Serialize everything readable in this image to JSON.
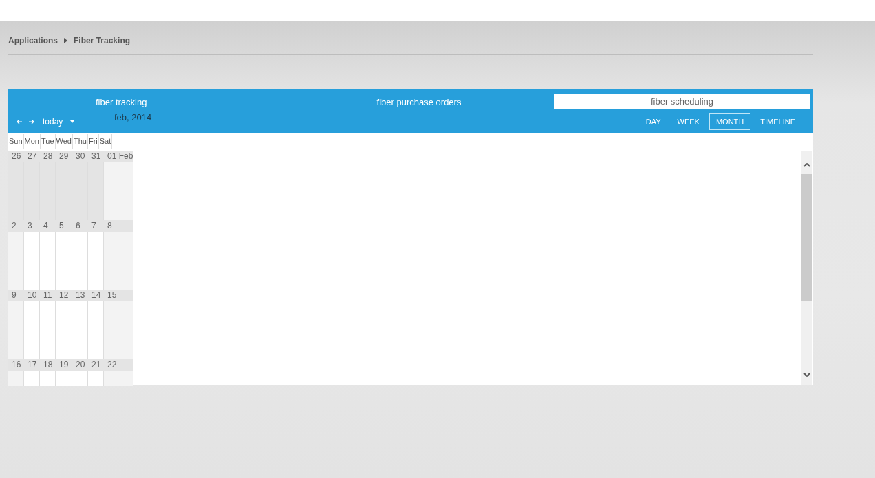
{
  "breadcrumb": [
    "Applications",
    "Fiber Tracking"
  ],
  "header": {
    "left_title": "fiber tracking",
    "center_title": "fiber purchase orders",
    "search": {
      "value": "fiber scheduling"
    },
    "today": "today",
    "month_label": "feb, 2014",
    "views": [
      {
        "label": "DAY",
        "selected": false
      },
      {
        "label": "WEEK",
        "selected": false
      },
      {
        "label": "MONTH",
        "selected": true
      },
      {
        "label": "TIMELINE",
        "selected": false
      }
    ]
  },
  "weekdays": [
    "Sun",
    "Mon",
    "Tue",
    "Wed",
    "Thu",
    "Fri",
    "Sat"
  ],
  "weeks": [
    [
      {
        "label": "26",
        "other_month": true
      },
      {
        "label": "27",
        "other_month": true
      },
      {
        "label": "28",
        "other_month": true
      },
      {
        "label": "29",
        "other_month": true
      },
      {
        "label": "30",
        "other_month": true
      },
      {
        "label": "31",
        "other_month": true
      },
      {
        "label": "01 Feb",
        "other_month": false
      }
    ],
    [
      {
        "label": "2",
        "other_month": false
      },
      {
        "label": "3",
        "other_month": false
      },
      {
        "label": "4",
        "other_month": false
      },
      {
        "label": "5",
        "other_month": false
      },
      {
        "label": "6",
        "other_month": false
      },
      {
        "label": "7",
        "other_month": false
      },
      {
        "label": "8",
        "other_month": false
      }
    ],
    [
      {
        "label": "9",
        "other_month": false
      },
      {
        "label": "10",
        "other_month": false
      },
      {
        "label": "11",
        "other_month": false
      },
      {
        "label": "12",
        "other_month": false
      },
      {
        "label": "13",
        "other_month": false
      },
      {
        "label": "14",
        "other_month": false
      },
      {
        "label": "15",
        "other_month": false
      }
    ],
    [
      {
        "label": "16",
        "other_month": false
      },
      {
        "label": "17",
        "other_month": false
      },
      {
        "label": "18",
        "other_month": false
      },
      {
        "label": "19",
        "other_month": false
      },
      {
        "label": "20",
        "other_month": false
      },
      {
        "label": "21",
        "other_month": false
      },
      {
        "label": "22",
        "other_month": false
      }
    ]
  ]
}
